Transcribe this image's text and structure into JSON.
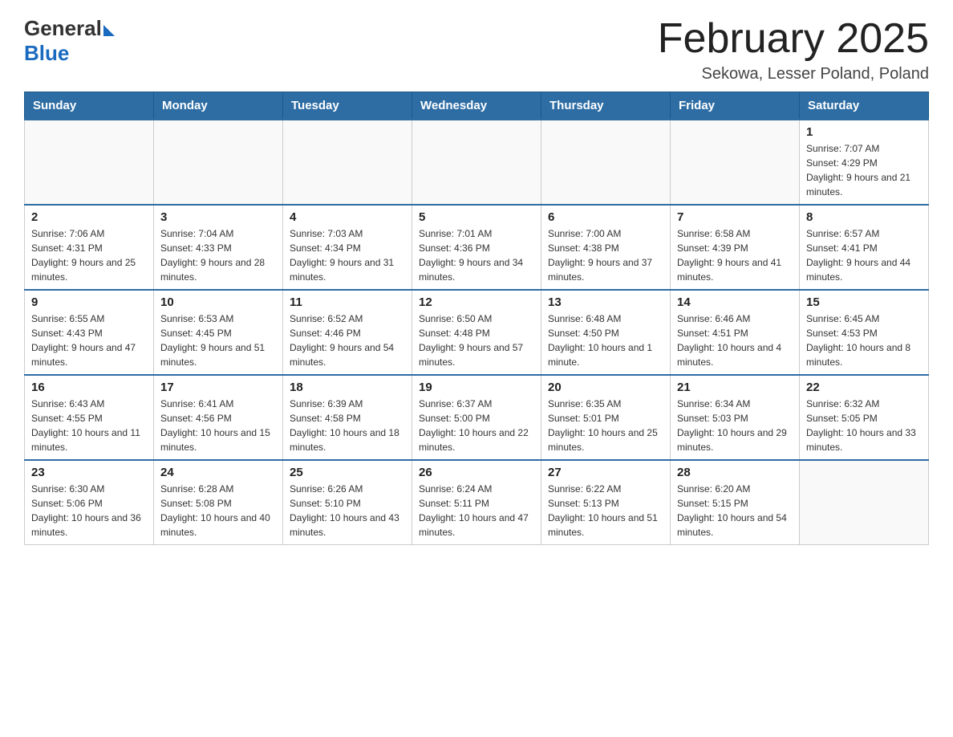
{
  "header": {
    "logo_general": "General",
    "logo_blue": "Blue",
    "title": "February 2025",
    "location": "Sekowa, Lesser Poland, Poland"
  },
  "weekdays": [
    "Sunday",
    "Monday",
    "Tuesday",
    "Wednesday",
    "Thursday",
    "Friday",
    "Saturday"
  ],
  "weeks": [
    [
      {
        "day": "",
        "info": ""
      },
      {
        "day": "",
        "info": ""
      },
      {
        "day": "",
        "info": ""
      },
      {
        "day": "",
        "info": ""
      },
      {
        "day": "",
        "info": ""
      },
      {
        "day": "",
        "info": ""
      },
      {
        "day": "1",
        "info": "Sunrise: 7:07 AM\nSunset: 4:29 PM\nDaylight: 9 hours and 21 minutes."
      }
    ],
    [
      {
        "day": "2",
        "info": "Sunrise: 7:06 AM\nSunset: 4:31 PM\nDaylight: 9 hours and 25 minutes."
      },
      {
        "day": "3",
        "info": "Sunrise: 7:04 AM\nSunset: 4:33 PM\nDaylight: 9 hours and 28 minutes."
      },
      {
        "day": "4",
        "info": "Sunrise: 7:03 AM\nSunset: 4:34 PM\nDaylight: 9 hours and 31 minutes."
      },
      {
        "day": "5",
        "info": "Sunrise: 7:01 AM\nSunset: 4:36 PM\nDaylight: 9 hours and 34 minutes."
      },
      {
        "day": "6",
        "info": "Sunrise: 7:00 AM\nSunset: 4:38 PM\nDaylight: 9 hours and 37 minutes."
      },
      {
        "day": "7",
        "info": "Sunrise: 6:58 AM\nSunset: 4:39 PM\nDaylight: 9 hours and 41 minutes."
      },
      {
        "day": "8",
        "info": "Sunrise: 6:57 AM\nSunset: 4:41 PM\nDaylight: 9 hours and 44 minutes."
      }
    ],
    [
      {
        "day": "9",
        "info": "Sunrise: 6:55 AM\nSunset: 4:43 PM\nDaylight: 9 hours and 47 minutes."
      },
      {
        "day": "10",
        "info": "Sunrise: 6:53 AM\nSunset: 4:45 PM\nDaylight: 9 hours and 51 minutes."
      },
      {
        "day": "11",
        "info": "Sunrise: 6:52 AM\nSunset: 4:46 PM\nDaylight: 9 hours and 54 minutes."
      },
      {
        "day": "12",
        "info": "Sunrise: 6:50 AM\nSunset: 4:48 PM\nDaylight: 9 hours and 57 minutes."
      },
      {
        "day": "13",
        "info": "Sunrise: 6:48 AM\nSunset: 4:50 PM\nDaylight: 10 hours and 1 minute."
      },
      {
        "day": "14",
        "info": "Sunrise: 6:46 AM\nSunset: 4:51 PM\nDaylight: 10 hours and 4 minutes."
      },
      {
        "day": "15",
        "info": "Sunrise: 6:45 AM\nSunset: 4:53 PM\nDaylight: 10 hours and 8 minutes."
      }
    ],
    [
      {
        "day": "16",
        "info": "Sunrise: 6:43 AM\nSunset: 4:55 PM\nDaylight: 10 hours and 11 minutes."
      },
      {
        "day": "17",
        "info": "Sunrise: 6:41 AM\nSunset: 4:56 PM\nDaylight: 10 hours and 15 minutes."
      },
      {
        "day": "18",
        "info": "Sunrise: 6:39 AM\nSunset: 4:58 PM\nDaylight: 10 hours and 18 minutes."
      },
      {
        "day": "19",
        "info": "Sunrise: 6:37 AM\nSunset: 5:00 PM\nDaylight: 10 hours and 22 minutes."
      },
      {
        "day": "20",
        "info": "Sunrise: 6:35 AM\nSunset: 5:01 PM\nDaylight: 10 hours and 25 minutes."
      },
      {
        "day": "21",
        "info": "Sunrise: 6:34 AM\nSunset: 5:03 PM\nDaylight: 10 hours and 29 minutes."
      },
      {
        "day": "22",
        "info": "Sunrise: 6:32 AM\nSunset: 5:05 PM\nDaylight: 10 hours and 33 minutes."
      }
    ],
    [
      {
        "day": "23",
        "info": "Sunrise: 6:30 AM\nSunset: 5:06 PM\nDaylight: 10 hours and 36 minutes."
      },
      {
        "day": "24",
        "info": "Sunrise: 6:28 AM\nSunset: 5:08 PM\nDaylight: 10 hours and 40 minutes."
      },
      {
        "day": "25",
        "info": "Sunrise: 6:26 AM\nSunset: 5:10 PM\nDaylight: 10 hours and 43 minutes."
      },
      {
        "day": "26",
        "info": "Sunrise: 6:24 AM\nSunset: 5:11 PM\nDaylight: 10 hours and 47 minutes."
      },
      {
        "day": "27",
        "info": "Sunrise: 6:22 AM\nSunset: 5:13 PM\nDaylight: 10 hours and 51 minutes."
      },
      {
        "day": "28",
        "info": "Sunrise: 6:20 AM\nSunset: 5:15 PM\nDaylight: 10 hours and 54 minutes."
      },
      {
        "day": "",
        "info": ""
      }
    ]
  ]
}
